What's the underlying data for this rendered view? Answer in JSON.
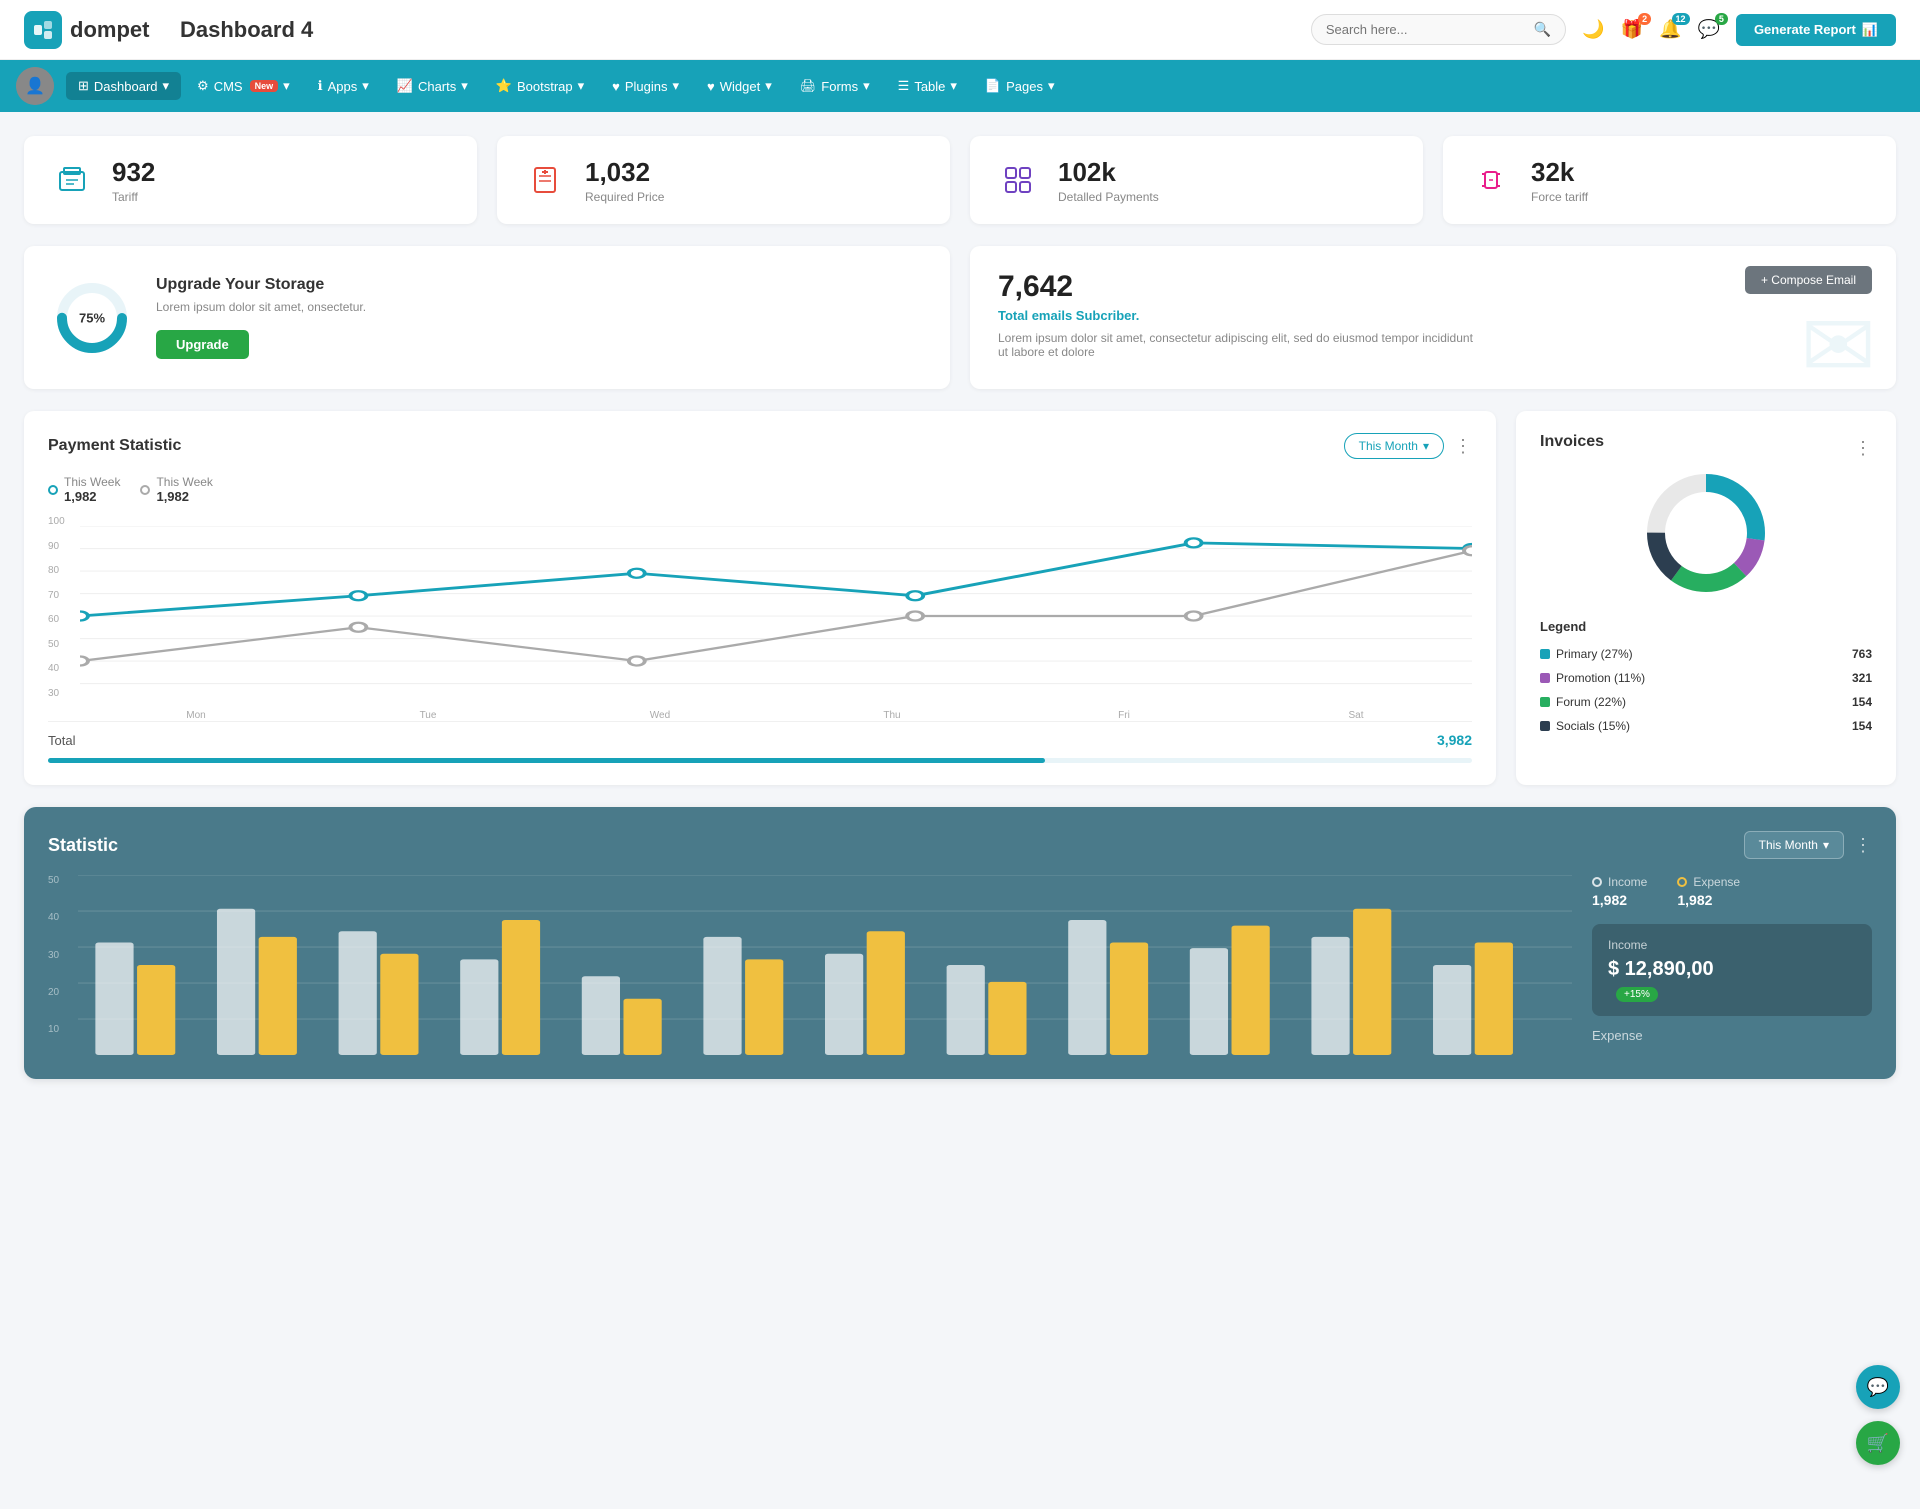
{
  "header": {
    "logo_text": "dompet",
    "page_title": "Dashboard 4",
    "search_placeholder": "Search here...",
    "generate_btn": "Generate Report",
    "badge_gift": "2",
    "badge_bell": "12",
    "badge_chat": "5"
  },
  "navbar": {
    "items": [
      {
        "label": "Dashboard",
        "active": true
      },
      {
        "label": "CMS",
        "badge": "New"
      },
      {
        "label": "Apps"
      },
      {
        "label": "Charts"
      },
      {
        "label": "Bootstrap"
      },
      {
        "label": "Plugins"
      },
      {
        "label": "Widget"
      },
      {
        "label": "Forms"
      },
      {
        "label": "Table"
      },
      {
        "label": "Pages"
      }
    ]
  },
  "stat_cards": [
    {
      "value": "932",
      "label": "Tariff",
      "icon": "briefcase",
      "color": "teal"
    },
    {
      "value": "1,032",
      "label": "Required Price",
      "icon": "file-plus",
      "color": "red"
    },
    {
      "value": "102k",
      "label": "Detalled Payments",
      "icon": "grid",
      "color": "purple"
    },
    {
      "value": "32k",
      "label": "Force tariff",
      "icon": "building",
      "color": "pink"
    }
  ],
  "storage": {
    "percent": "75%",
    "title": "Upgrade Your Storage",
    "description": "Lorem ipsum dolor sit amet, onsectetur.",
    "btn_label": "Upgrade",
    "donut_pct": 75
  },
  "email": {
    "count": "7,642",
    "subtitle": "Total emails Subcriber.",
    "description": "Lorem ipsum dolor sit amet, consectetur adipiscing elit, sed do eiusmod tempor incididunt ut labore et dolore",
    "compose_btn": "+ Compose Email"
  },
  "payment": {
    "title": "Payment Statistic",
    "filter": "This Month",
    "legend1_label": "This Week",
    "legend1_value": "1,982",
    "legend2_label": "This Week",
    "legend2_value": "1,982",
    "total_label": "Total",
    "total_value": "3,982",
    "x_labels": [
      "Mon",
      "Tue",
      "Wed",
      "Thu",
      "Fri",
      "Sat"
    ],
    "y_labels": [
      "100",
      "90",
      "80",
      "70",
      "60",
      "50",
      "40",
      "30"
    ]
  },
  "invoices": {
    "title": "Invoices",
    "legend": [
      {
        "label": "Primary (27%)",
        "color": "#17a2b8",
        "count": "763"
      },
      {
        "label": "Promotion (11%)",
        "color": "#9b59b6",
        "count": "321"
      },
      {
        "label": "Forum (22%)",
        "color": "#27ae60",
        "count": "154"
      },
      {
        "label": "Socials (15%)",
        "color": "#2c3e50",
        "count": "154"
      }
    ]
  },
  "statistic": {
    "title": "Statistic",
    "filter": "This Month",
    "income_label": "Income",
    "income_value": "1,982",
    "expense_label": "Expense",
    "expense_value": "1,982",
    "detail_label": "Income",
    "detail_value": "$ 12,890,00",
    "detail_badge": "+15%",
    "expense_section": "Expense",
    "y_labels": [
      "50",
      "40",
      "30",
      "20",
      "10"
    ],
    "x_labels": [
      "",
      "",
      "",
      "",
      "",
      "",
      "",
      "",
      "",
      "",
      "",
      ""
    ]
  }
}
